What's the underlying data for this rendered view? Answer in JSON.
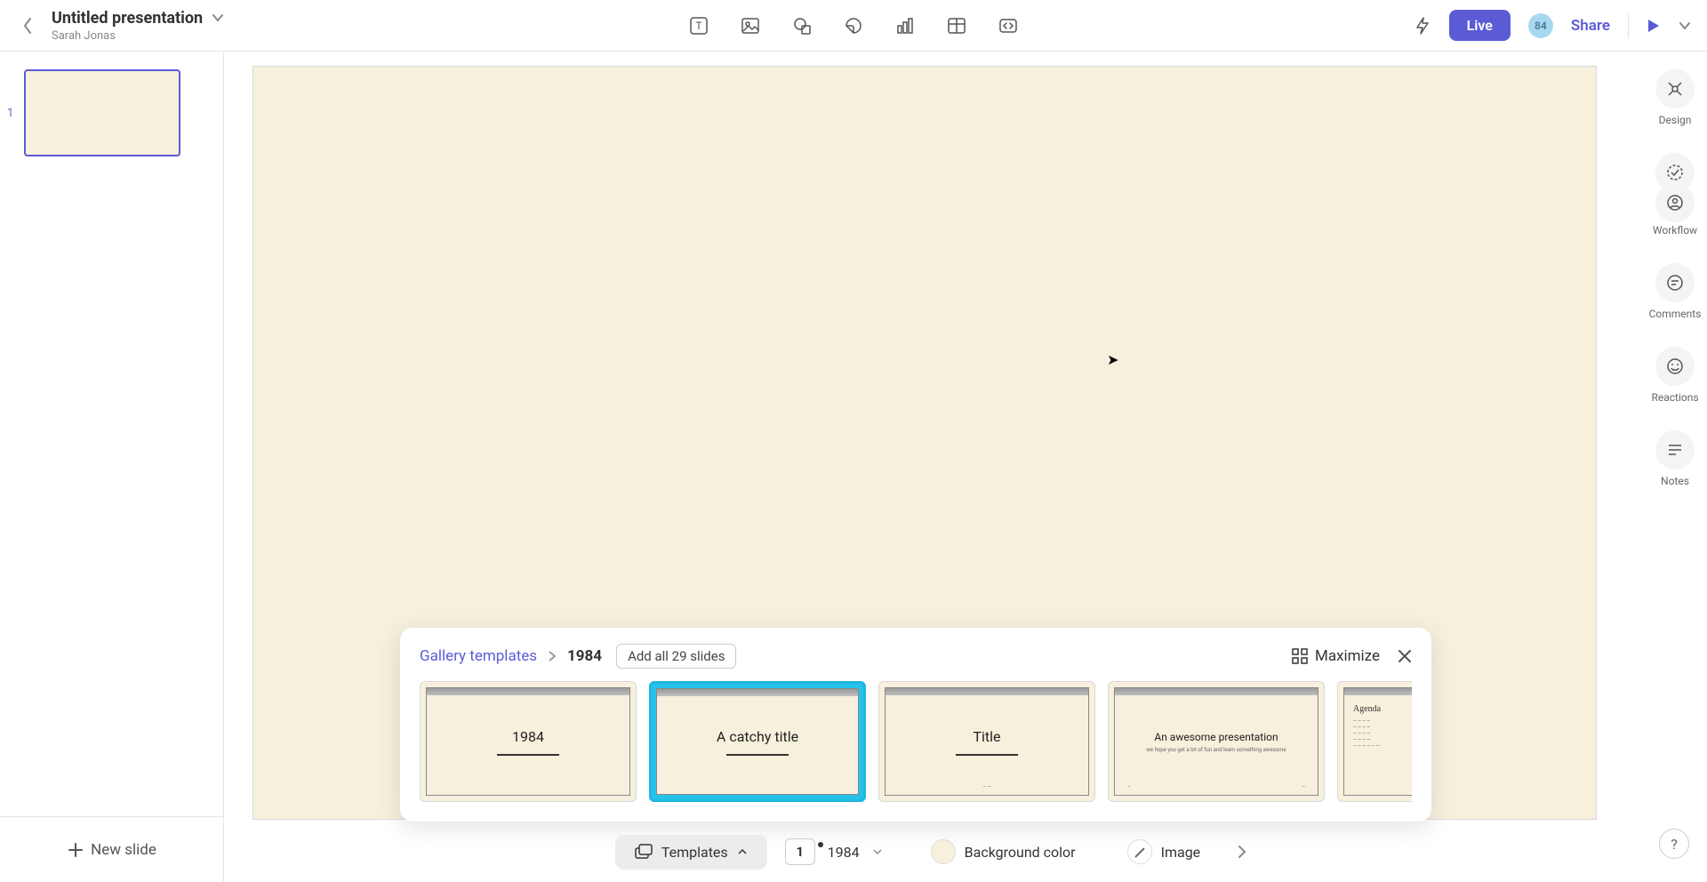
{
  "header": {
    "title": "Untitled presentation",
    "author": "Sarah Jonas",
    "live_label": "Live",
    "avatar_initials": "84",
    "share_label": "Share"
  },
  "left_rail": {
    "slides": [
      {
        "index": "1"
      }
    ],
    "new_slide_label": "New slide"
  },
  "right_rail": {
    "items": [
      {
        "label": "Design"
      },
      {
        "label": "Workflow"
      },
      {
        "label": "Comments"
      },
      {
        "label": "Reactions"
      },
      {
        "label": "Notes"
      }
    ]
  },
  "picker": {
    "breadcrumb_root": "Gallery templates",
    "breadcrumb_current": "1984",
    "add_all_label": "Add all 29 slides",
    "maximize_label": "Maximize",
    "templates": [
      {
        "title": "1984"
      },
      {
        "title": "A catchy title"
      },
      {
        "title": "Title"
      },
      {
        "title": "An awesome presentation",
        "subtitle": "we hope you get a lot of fun and learn something awesome"
      },
      {
        "title": "Agenda"
      }
    ]
  },
  "bottom_bar": {
    "templates_label": "Templates",
    "selected_index": "1",
    "selected_name": "1984",
    "background_label": "Background color",
    "image_label": "Image"
  }
}
